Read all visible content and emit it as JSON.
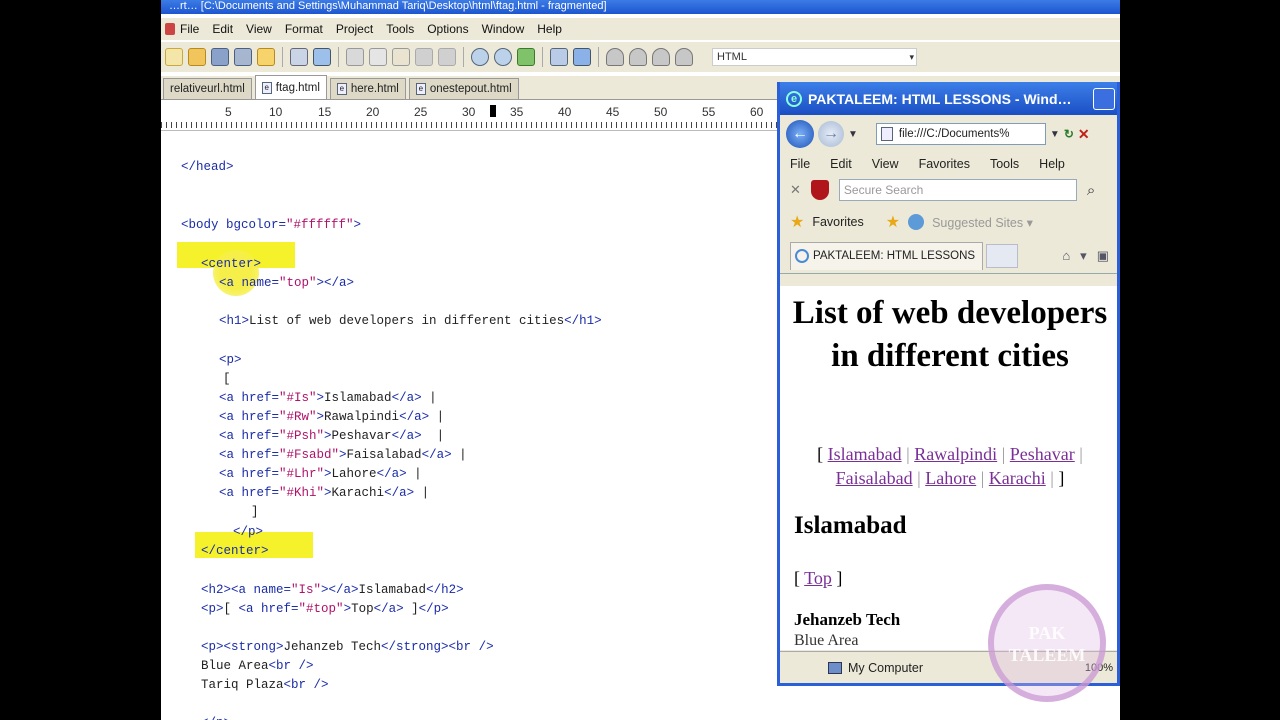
{
  "editor": {
    "title": "…rt… [C:\\Documents and Settings\\Muhammad Tariq\\Desktop\\html\\ftag.html - fragmented]",
    "menu": [
      "File",
      "Edit",
      "View",
      "Format",
      "Project",
      "Tools",
      "Options",
      "Window",
      "Help"
    ],
    "toolbar_combo": "HTML",
    "tabs": [
      {
        "label": "relativeurl.html"
      },
      {
        "label": "ftag.html"
      },
      {
        "label": "here.html"
      },
      {
        "label": "onestepout.html"
      }
    ],
    "ruler": [
      "5",
      "10",
      "15",
      "20",
      "25",
      "30",
      "35",
      "40",
      "45",
      "50",
      "55",
      "60"
    ],
    "code_lines": [
      {
        "parts": [
          [
            "tag",
            "</head>"
          ]
        ]
      },
      {
        "parts": [
          [
            "tag",
            "<body bgcolor="
          ],
          [
            "val",
            "\"#ffffff\""
          ],
          [
            "tag",
            ">"
          ]
        ]
      },
      {
        "parts": [
          [
            "tag",
            "<center>"
          ]
        ]
      },
      {
        "parts": [
          [
            "tag",
            "<a name="
          ],
          [
            "val",
            "\"top\""
          ],
          [
            "tag",
            "></a>"
          ]
        ]
      },
      {
        "parts": [
          [
            "tag",
            "<h1>"
          ],
          [
            "txt",
            "List of web developers in different cities"
          ],
          [
            "tag",
            "</h1>"
          ]
        ]
      },
      {
        "parts": [
          [
            "tag",
            "<p>"
          ]
        ]
      },
      {
        "parts": [
          [
            "txt",
            "["
          ]
        ]
      },
      {
        "parts": [
          [
            "tag",
            "<a href="
          ],
          [
            "val",
            "\"#Is\""
          ],
          [
            "tag",
            ">"
          ],
          [
            "txt",
            "Islamabad"
          ],
          [
            "tag",
            "</a>"
          ],
          [
            "txt",
            " |"
          ]
        ]
      },
      {
        "parts": [
          [
            "tag",
            "<a href="
          ],
          [
            "val",
            "\"#Rw\""
          ],
          [
            "tag",
            ">"
          ],
          [
            "txt",
            "Rawalpindi"
          ],
          [
            "tag",
            "</a>"
          ],
          [
            "txt",
            " |"
          ]
        ]
      },
      {
        "parts": [
          [
            "tag",
            "<a href="
          ],
          [
            "val",
            "\"#Psh\""
          ],
          [
            "tag",
            ">"
          ],
          [
            "txt",
            "Peshavar"
          ],
          [
            "tag",
            "</a>"
          ],
          [
            "txt",
            "  |"
          ]
        ]
      },
      {
        "parts": [
          [
            "tag",
            "<a href="
          ],
          [
            "val",
            "\"#Fsabd\""
          ],
          [
            "tag",
            ">"
          ],
          [
            "txt",
            "Faisalabad"
          ],
          [
            "tag",
            "</a>"
          ],
          [
            "txt",
            " |"
          ]
        ]
      },
      {
        "parts": [
          [
            "tag",
            "<a href="
          ],
          [
            "val",
            "\"#Lhr\""
          ],
          [
            "tag",
            ">"
          ],
          [
            "txt",
            "Lahore"
          ],
          [
            "tag",
            "</a>"
          ],
          [
            "txt",
            " |"
          ]
        ]
      },
      {
        "parts": [
          [
            "tag",
            "<a href="
          ],
          [
            "val",
            "\"#Khi\""
          ],
          [
            "tag",
            ">"
          ],
          [
            "txt",
            "Karachi"
          ],
          [
            "tag",
            "</a>"
          ],
          [
            "txt",
            " |"
          ]
        ]
      },
      {
        "parts": [
          [
            "txt",
            "]"
          ]
        ]
      },
      {
        "parts": [
          [
            "tag",
            "</p>"
          ]
        ]
      },
      {
        "parts": [
          [
            "tag",
            "</center>"
          ]
        ]
      },
      {
        "parts": [
          [
            "tag",
            "<h2><a name="
          ],
          [
            "val",
            "\"Is\""
          ],
          [
            "tag",
            "></a>"
          ],
          [
            "txt",
            "Islamabad"
          ],
          [
            "tag",
            "</h2>"
          ]
        ]
      },
      {
        "parts": [
          [
            "tag",
            "<p>"
          ],
          [
            "txt",
            "[ "
          ],
          [
            "tag",
            "<a href="
          ],
          [
            "val",
            "\"#top\""
          ],
          [
            "tag",
            ">"
          ],
          [
            "txt",
            "Top"
          ],
          [
            "tag",
            "</a>"
          ],
          [
            "txt",
            " ]"
          ],
          [
            "tag",
            "</p>"
          ]
        ]
      },
      {
        "parts": [
          [
            "tag",
            "<p><strong>"
          ],
          [
            "txt",
            "Jehanzeb Tech"
          ],
          [
            "tag",
            "</strong><br />"
          ]
        ]
      },
      {
        "parts": [
          [
            "txt",
            "Blue Area"
          ],
          [
            "tag",
            "<br />"
          ]
        ]
      },
      {
        "parts": [
          [
            "txt",
            "Tariq Plaza"
          ],
          [
            "tag",
            "<br />"
          ]
        ]
      },
      {
        "parts": [
          [
            "tag",
            "</p>"
          ]
        ]
      }
    ]
  },
  "browser": {
    "title": "PAKTALEEM: HTML LESSONS - Wind…",
    "address": "file:///C:/Documents%",
    "menu": [
      "File",
      "Edit",
      "View",
      "Favorites",
      "Tools",
      "Help"
    ],
    "search_placeholder": "Secure Search",
    "favorites_label": "Favorites",
    "suggested_sites": "Suggested Sites ▾",
    "tab_label": "PAKTALEEM: HTML LESSONS",
    "page": {
      "h1": "List of web developers in different cities",
      "links": [
        "Islamabad",
        "Rawalpindi",
        "Peshavar",
        "Faisalabad",
        "Lahore",
        "Karachi"
      ],
      "h2": "Islamabad",
      "top_link": "Top",
      "strong": "Jehanzeb Tech",
      "line1": "Blue Area"
    },
    "status": "My Computer",
    "zoom": "100%"
  },
  "watermark": "PAK TALEEM",
  "colors": {
    "titlebar": "#1d56d0",
    "highlight": "#f5f22b",
    "tag": "#1a2ca8",
    "attr_value": "#b0126a",
    "visited_link": "#7a2f97"
  }
}
